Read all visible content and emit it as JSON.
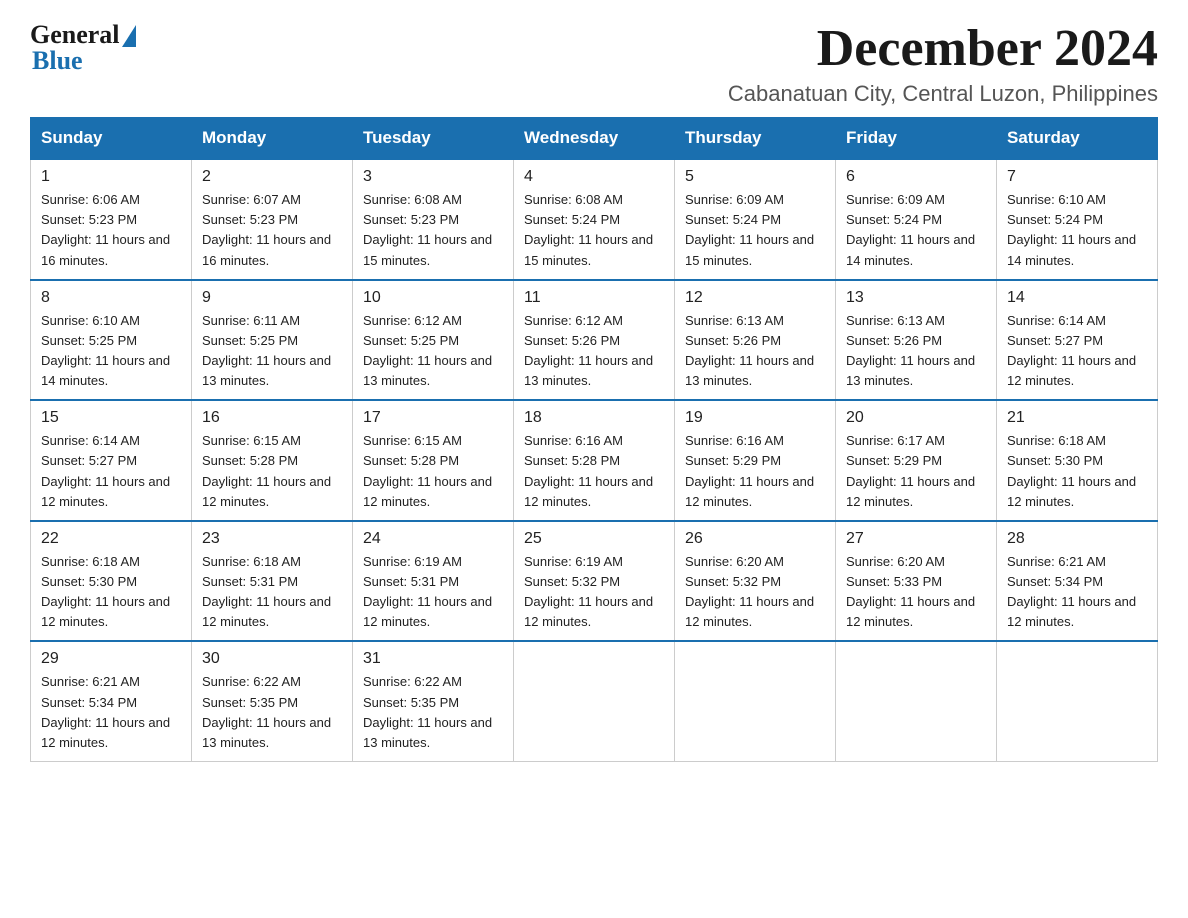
{
  "header": {
    "logo_general": "General",
    "logo_blue": "Blue",
    "month_title": "December 2024",
    "location": "Cabanatuan City, Central Luzon, Philippines"
  },
  "weekdays": [
    "Sunday",
    "Monday",
    "Tuesday",
    "Wednesday",
    "Thursday",
    "Friday",
    "Saturday"
  ],
  "weeks": [
    [
      {
        "day": 1,
        "sunrise": "6:06 AM",
        "sunset": "5:23 PM",
        "daylight": "11 hours and 16 minutes"
      },
      {
        "day": 2,
        "sunrise": "6:07 AM",
        "sunset": "5:23 PM",
        "daylight": "11 hours and 16 minutes"
      },
      {
        "day": 3,
        "sunrise": "6:08 AM",
        "sunset": "5:23 PM",
        "daylight": "11 hours and 15 minutes"
      },
      {
        "day": 4,
        "sunrise": "6:08 AM",
        "sunset": "5:24 PM",
        "daylight": "11 hours and 15 minutes"
      },
      {
        "day": 5,
        "sunrise": "6:09 AM",
        "sunset": "5:24 PM",
        "daylight": "11 hours and 15 minutes"
      },
      {
        "day": 6,
        "sunrise": "6:09 AM",
        "sunset": "5:24 PM",
        "daylight": "11 hours and 14 minutes"
      },
      {
        "day": 7,
        "sunrise": "6:10 AM",
        "sunset": "5:24 PM",
        "daylight": "11 hours and 14 minutes"
      }
    ],
    [
      {
        "day": 8,
        "sunrise": "6:10 AM",
        "sunset": "5:25 PM",
        "daylight": "11 hours and 14 minutes"
      },
      {
        "day": 9,
        "sunrise": "6:11 AM",
        "sunset": "5:25 PM",
        "daylight": "11 hours and 13 minutes"
      },
      {
        "day": 10,
        "sunrise": "6:12 AM",
        "sunset": "5:25 PM",
        "daylight": "11 hours and 13 minutes"
      },
      {
        "day": 11,
        "sunrise": "6:12 AM",
        "sunset": "5:26 PM",
        "daylight": "11 hours and 13 minutes"
      },
      {
        "day": 12,
        "sunrise": "6:13 AM",
        "sunset": "5:26 PM",
        "daylight": "11 hours and 13 minutes"
      },
      {
        "day": 13,
        "sunrise": "6:13 AM",
        "sunset": "5:26 PM",
        "daylight": "11 hours and 13 minutes"
      },
      {
        "day": 14,
        "sunrise": "6:14 AM",
        "sunset": "5:27 PM",
        "daylight": "11 hours and 12 minutes"
      }
    ],
    [
      {
        "day": 15,
        "sunrise": "6:14 AM",
        "sunset": "5:27 PM",
        "daylight": "11 hours and 12 minutes"
      },
      {
        "day": 16,
        "sunrise": "6:15 AM",
        "sunset": "5:28 PM",
        "daylight": "11 hours and 12 minutes"
      },
      {
        "day": 17,
        "sunrise": "6:15 AM",
        "sunset": "5:28 PM",
        "daylight": "11 hours and 12 minutes"
      },
      {
        "day": 18,
        "sunrise": "6:16 AM",
        "sunset": "5:28 PM",
        "daylight": "11 hours and 12 minutes"
      },
      {
        "day": 19,
        "sunrise": "6:16 AM",
        "sunset": "5:29 PM",
        "daylight": "11 hours and 12 minutes"
      },
      {
        "day": 20,
        "sunrise": "6:17 AM",
        "sunset": "5:29 PM",
        "daylight": "11 hours and 12 minutes"
      },
      {
        "day": 21,
        "sunrise": "6:18 AM",
        "sunset": "5:30 PM",
        "daylight": "11 hours and 12 minutes"
      }
    ],
    [
      {
        "day": 22,
        "sunrise": "6:18 AM",
        "sunset": "5:30 PM",
        "daylight": "11 hours and 12 minutes"
      },
      {
        "day": 23,
        "sunrise": "6:18 AM",
        "sunset": "5:31 PM",
        "daylight": "11 hours and 12 minutes"
      },
      {
        "day": 24,
        "sunrise": "6:19 AM",
        "sunset": "5:31 PM",
        "daylight": "11 hours and 12 minutes"
      },
      {
        "day": 25,
        "sunrise": "6:19 AM",
        "sunset": "5:32 PM",
        "daylight": "11 hours and 12 minutes"
      },
      {
        "day": 26,
        "sunrise": "6:20 AM",
        "sunset": "5:32 PM",
        "daylight": "11 hours and 12 minutes"
      },
      {
        "day": 27,
        "sunrise": "6:20 AM",
        "sunset": "5:33 PM",
        "daylight": "11 hours and 12 minutes"
      },
      {
        "day": 28,
        "sunrise": "6:21 AM",
        "sunset": "5:34 PM",
        "daylight": "11 hours and 12 minutes"
      }
    ],
    [
      {
        "day": 29,
        "sunrise": "6:21 AM",
        "sunset": "5:34 PM",
        "daylight": "11 hours and 12 minutes"
      },
      {
        "day": 30,
        "sunrise": "6:22 AM",
        "sunset": "5:35 PM",
        "daylight": "11 hours and 13 minutes"
      },
      {
        "day": 31,
        "sunrise": "6:22 AM",
        "sunset": "5:35 PM",
        "daylight": "11 hours and 13 minutes"
      },
      null,
      null,
      null,
      null
    ]
  ]
}
